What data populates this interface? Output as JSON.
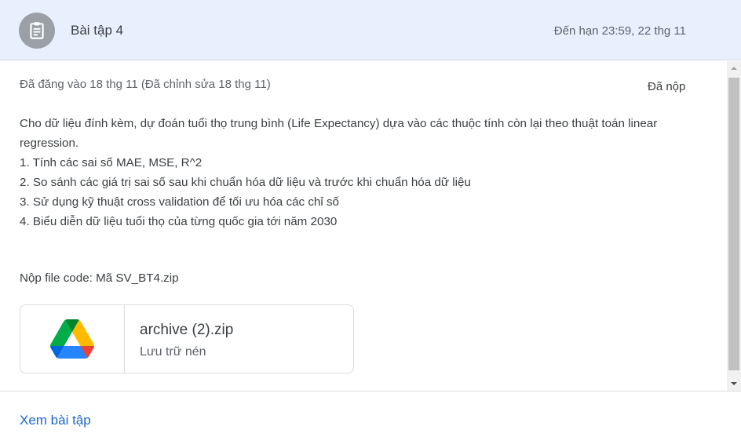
{
  "header": {
    "title": "Bài tập 4",
    "due": "Đến hạn 23:59, 22 thg 11",
    "icon": "assignment-icon"
  },
  "post": {
    "posted": "Đã đăng vào 18 thg 11 (Đã chỉnh sửa 18 thg 11)",
    "status": "Đã nộp",
    "lines": [
      "Cho dữ liệu đính kèm, dự đoán tuổi thọ trung bình (Life Expectancy) dựa vào các thuộc tính còn lại theo thuật toán linear regression.",
      "1. Tính các sai số MAE, MSE, R^2",
      "2. So sánh các giá trị sai số sau khi chuẩn hóa dữ liệu và trước khi chuẩn hóa dữ liệu",
      "3. Sử dụng kỹ thuật cross validation để tối ưu hóa các chỉ số",
      "4. Biểu diễn dữ liệu tuổi thọ của từng quốc gia tới năm 2030"
    ],
    "submit_note": "Nộp file code: Mã SV_BT4.zip"
  },
  "attachment": {
    "name": "archive (2).zip",
    "type": "Lưu trữ nén",
    "icon": "google-drive-icon"
  },
  "footer": {
    "view_label": "Xem bài tập"
  },
  "colors": {
    "header_bg": "#e8f0fe",
    "link": "#1967d2",
    "avatar": "#9aa0a6"
  }
}
